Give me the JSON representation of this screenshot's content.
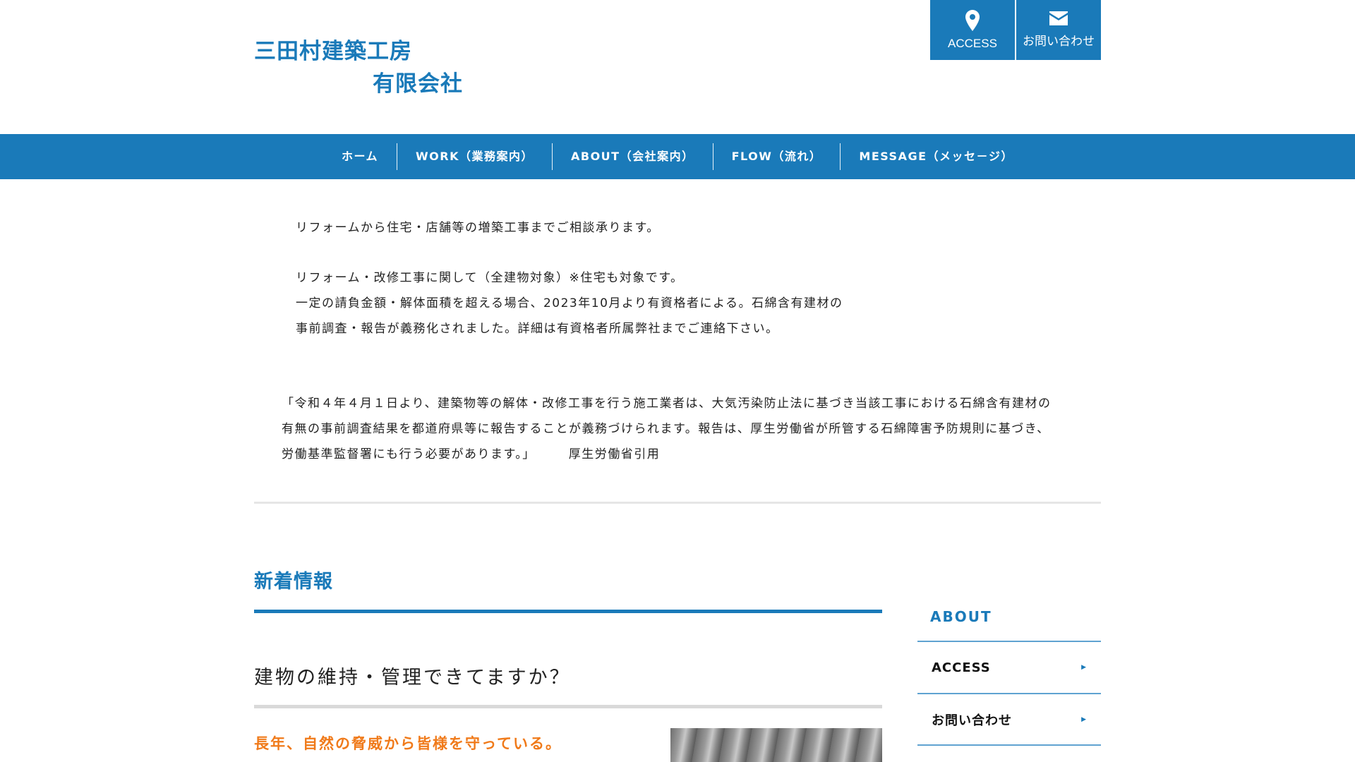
{
  "header": {
    "logo_line1": "三田村建築工房",
    "logo_line2": "有限会社",
    "access_label": "ACCESS",
    "contact_label": "お問い合わせ"
  },
  "nav": {
    "items": [
      {
        "label": "ホーム"
      },
      {
        "label": "WORK（業務案内）"
      },
      {
        "label": "ABOUT（会社案内）"
      },
      {
        "label": "FLOW（流れ）"
      },
      {
        "label": "MESSAGE（メッセ－ジ）"
      }
    ]
  },
  "intro": {
    "line1": "リフォームから住宅・店舗等の増築工事までご相談承ります。",
    "line2": "リフォーム・改修工事に関して（全建物対象）※住宅も対象です。",
    "line3": "一定の請負金額・解体面積を超える場合、2023年10月より有資格者による。石綿含有建材の",
    "line4": "事前調査・報告が義務化されました。詳細は有資格者所属弊社までご連絡下さい。"
  },
  "quote": {
    "line1": "「令和４年４月１日より、建築物等の解体・改修工事を行う施工業者は、大気汚染防止法に基づき当該工事における石綿含有建材の",
    "line2": "有無の事前調査結果を都道府県等に報告することが義務づけられます。報告は、厚生労働省が所管する石綿障害予防規則に基づき、",
    "line3": "労働基準監督署にも行う必要があります。」　　　厚生労働省引用"
  },
  "news": {
    "title": "新着情報",
    "post_title": "建物の維持・管理できてますか？",
    "post_lead": "長年、自然の脅威から皆様を守っている。"
  },
  "sidebar": {
    "title": "ABOUT",
    "items": [
      {
        "label": "ACCESS"
      },
      {
        "label": "お問い合わせ"
      }
    ]
  },
  "colors": {
    "brand_blue": "#1a7ab9",
    "accent_orange": "#f07a1a"
  }
}
